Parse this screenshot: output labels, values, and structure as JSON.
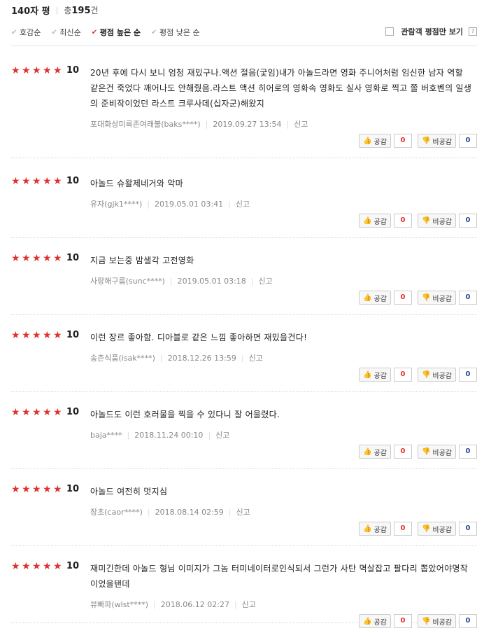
{
  "header": {
    "title": "140자 평",
    "total_prefix": "총",
    "total_count": "195",
    "total_suffix": "건"
  },
  "sort": [
    {
      "label": "호감순",
      "active": false
    },
    {
      "label": "최신순",
      "active": false
    },
    {
      "label": "평점 높은 순",
      "active": true
    },
    {
      "label": "평점 낮은 순",
      "active": false
    }
  ],
  "audience_only_label": "관람객 평점만 보기",
  "help_label": "?",
  "labels": {
    "like": "공감",
    "dislike": "비공감",
    "report": "신고"
  },
  "reviews": [
    {
      "score": "10",
      "text": "20년 후에 다시 보니 엄청 재밌구나.액션 절음(궃임)내가 아놀드라면 영화 주니어처럼 임신한 남자 역할 같은건 죽었다 깨어나도 안해줬음.라스트 액션 히어로의 영화속 영화도 실사 영화로 찍고 쫄 버호벤의 일생의 준비작이었던 라스트 크루사데(십자군)해왔지",
      "user": "포대화상미륵존여래불(baks****)",
      "date": "2019.09.27 13:54",
      "likes": "0",
      "dislikes": "0"
    },
    {
      "score": "10",
      "text": "아놀드 슈왈제네거와 악마",
      "user": "유자(gjk1****)",
      "date": "2019.05.01 03:41",
      "likes": "0",
      "dislikes": "0"
    },
    {
      "score": "10",
      "text": "지금 보는중 밤샐각 고전영화",
      "user": "사랑해구름(sunc****)",
      "date": "2019.05.01 03:18",
      "likes": "0",
      "dislikes": "0"
    },
    {
      "score": "10",
      "text": "이런 장르 좋아함. 디아블로 같은 느낌 좋아하면 재밌을건다!",
      "user": "송촌식품(isak****)",
      "date": "2018.12.26 13:59",
      "likes": "0",
      "dislikes": "0"
    },
    {
      "score": "10",
      "text": "아놀드도 이런 호러물을 찍을 수 있다니 잘 어울렸다.",
      "user": "baja****",
      "date": "2018.11.24 00:10",
      "likes": "0",
      "dislikes": "0"
    },
    {
      "score": "10",
      "text": "아놀드 여전히 멋지심",
      "user": "장초(caor****)",
      "date": "2018.08.14 02:59",
      "likes": "0",
      "dislikes": "0"
    },
    {
      "score": "10",
      "text": "재미긴한데 아놀드 형님 이미지가 그놈 터미네이터로인식되서 그런가 사탄 멱살잡고 팔다리 뽑았어야명작이었을탠데",
      "user": "뷰빠파(wlst****)",
      "date": "2018.06.12 02:27",
      "likes": "0",
      "dislikes": "0"
    }
  ]
}
